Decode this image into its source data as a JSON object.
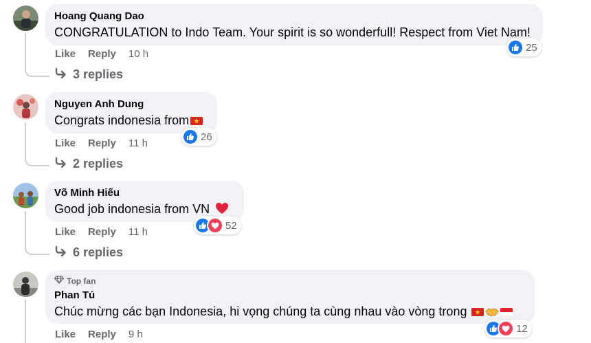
{
  "comments": [
    {
      "author": "Hoang Quang Dao",
      "text": "CONGRATULATION to Indo Team. Your spirit is so wonderfull! Respect from Viet Nam!",
      "like_label": "Like",
      "reply_label": "Reply",
      "time": "10 h",
      "reaction_count": "25",
      "reactions": [
        "like-icon"
      ],
      "replies_label": "3 replies"
    },
    {
      "author": "Nguyen Anh Dung",
      "text": "Congrats indonesia from",
      "like_label": "Like",
      "reply_label": "Reply",
      "time": "11 h",
      "reaction_count": "26",
      "reactions": [
        "like-icon"
      ],
      "replies_label": "2 replies"
    },
    {
      "author": "Võ Minh Hiếu",
      "text": "Good job indonesia from VN",
      "like_label": "Like",
      "reply_label": "Reply",
      "time": "11 h",
      "reaction_count": "52",
      "reactions": [
        "like-icon",
        "love-icon"
      ],
      "replies_label": "6 replies"
    },
    {
      "badge": "Top fan",
      "author": "Phan Tú",
      "text": "Chúc mừng các bạn Indonesia, hi vọng chúng ta cùng nhau vào vòng trong",
      "like_label": "Like",
      "reply_label": "Reply",
      "time": "9 h",
      "reaction_count": "12",
      "reactions": [
        "like-icon",
        "love-icon"
      ]
    }
  ],
  "colors": {
    "bubble": "#f0f2f5",
    "meta_text": "#65676b",
    "like_blue": "#1877f2",
    "love_red": "#f33e58"
  }
}
